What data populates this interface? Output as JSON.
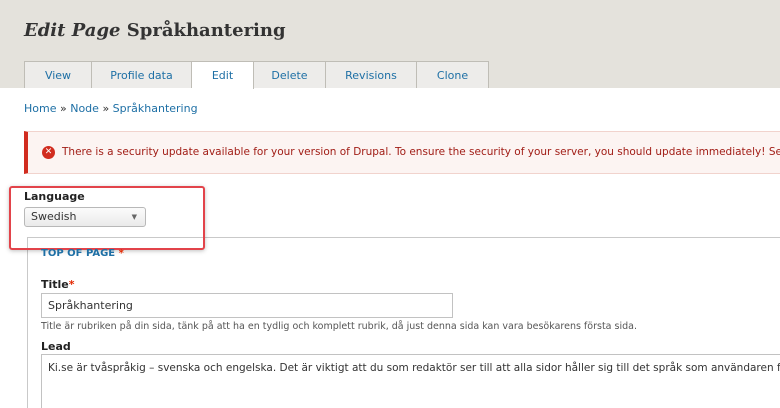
{
  "page": {
    "title_operation": "Edit Page",
    "title_name": "Språkhantering"
  },
  "tabs": [
    {
      "label": "View",
      "active": false
    },
    {
      "label": "Profile data",
      "active": false
    },
    {
      "label": "Edit",
      "active": true
    },
    {
      "label": "Delete",
      "active": false
    },
    {
      "label": "Revisions",
      "active": false
    },
    {
      "label": "Clone",
      "active": false
    }
  ],
  "breadcrumb": {
    "items": [
      "Home",
      "Node",
      "Språkhantering"
    ],
    "separator": "»"
  },
  "alert": {
    "icon": "error-circle-icon",
    "text": "There is a security update available for your version of Drupal. To ensure the security of your server, you should update immediately! See the"
  },
  "language": {
    "label": "Language",
    "selected": "Swedish"
  },
  "section": {
    "legend": "TOP OF PAGE",
    "required_mark": "*"
  },
  "title_field": {
    "label": "Title",
    "required_mark": "*",
    "value": "Språkhantering",
    "help": "Title är rubriken på din sida, tänk på att ha en tydlig och komplett rubrik, då just denna sida kan vara besökarens första sida."
  },
  "lead_field": {
    "label": "Lead",
    "value": "Ki.se är tvåspråkig – svenska och engelska. Det är viktigt att du som redaktör ser till att alla sidor håller sig till det språk som användaren förvä"
  },
  "colors": {
    "link": "#1d6fa5",
    "error": "#d12c1f",
    "highlight": "#e2434a",
    "header_bg": "#e4e2dc"
  }
}
